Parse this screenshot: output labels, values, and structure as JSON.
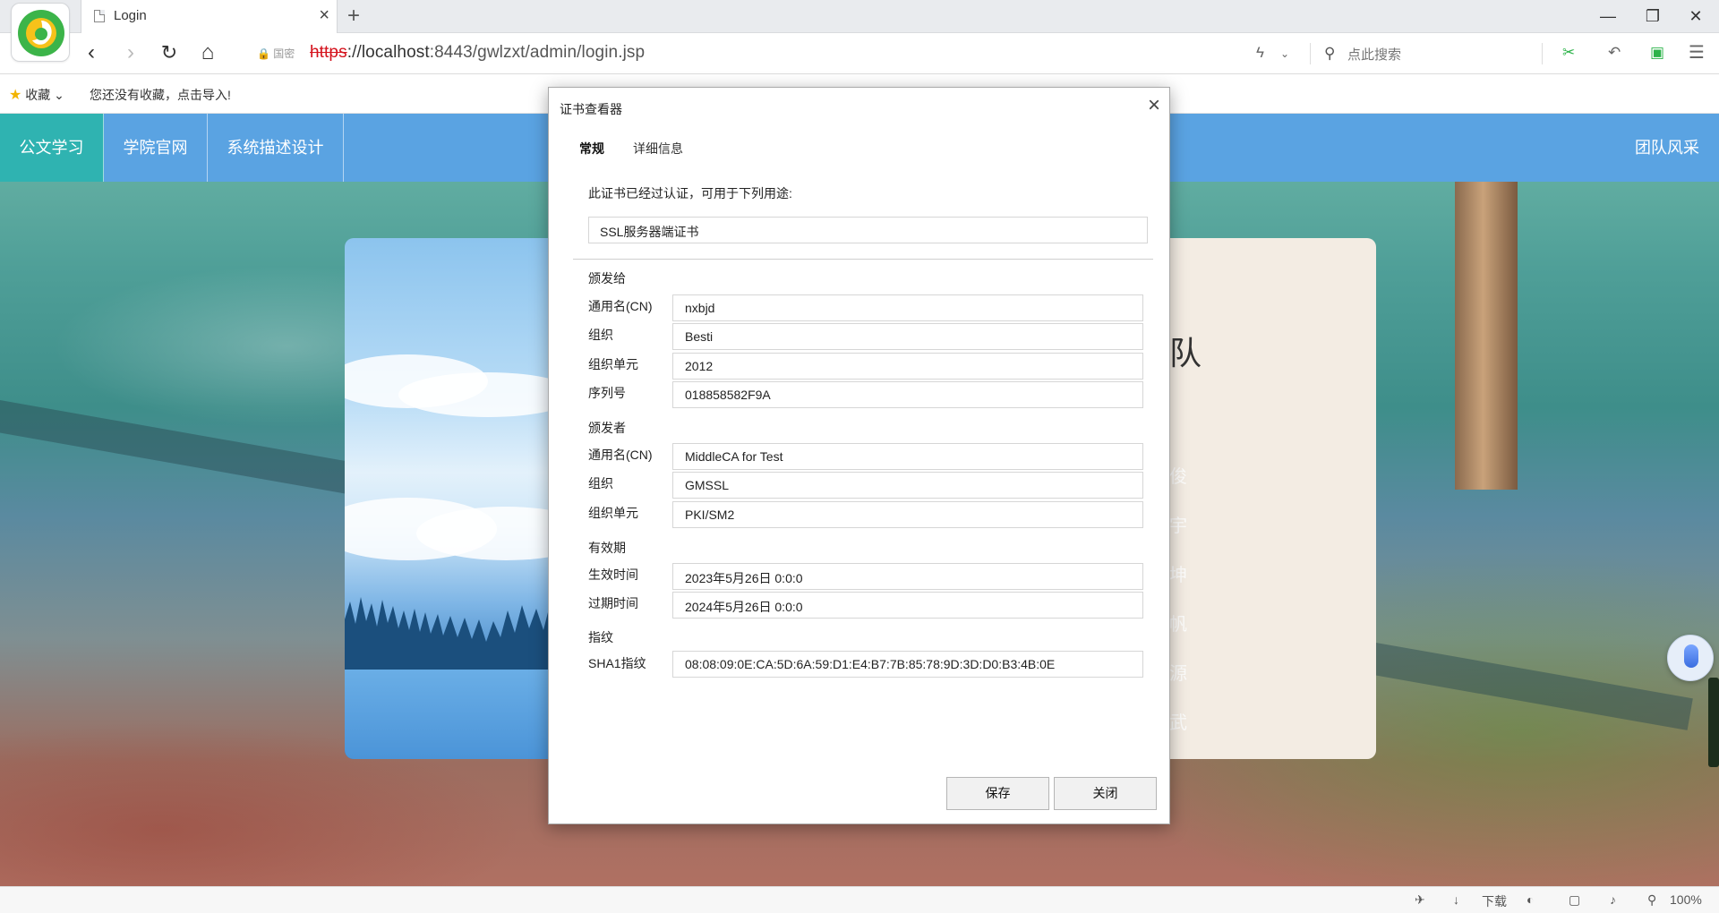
{
  "browser": {
    "tab_title": "Login",
    "tab_close": "×",
    "new_tab": "+",
    "security_label": "国密",
    "url_scheme": "https",
    "url_host": "://localhost",
    "url_rest": ":8443/gwlzxt/admin/login.jsp",
    "search_placeholder": "点此搜索",
    "window_controls": {
      "minimize": "—",
      "restore": "❐",
      "close": "✕"
    },
    "nav": {
      "back": "‹",
      "forward": "›",
      "reload": "↻",
      "home": "⌂"
    },
    "toolbar_icons": [
      "lightning-icon",
      "scissors-icon",
      "undo-icon",
      "chat-icon",
      "menu-icon"
    ]
  },
  "favorites": {
    "label": "收藏",
    "empty_text": "您还没有收藏，点击导入!"
  },
  "site_nav": {
    "items": [
      {
        "label": "公文学习"
      },
      {
        "label": "学院官网"
      },
      {
        "label": "系统描述设计"
      }
    ],
    "right": "团队风采"
  },
  "card_right": {
    "heading_glyph": "队",
    "side_glyphs": [
      "俊",
      "宇",
      "坤",
      "帆",
      "源",
      "武"
    ]
  },
  "dialog": {
    "title": "证书查看器",
    "close": "×",
    "tabs": [
      {
        "label": "常规",
        "active": true
      },
      {
        "label": "详细信息",
        "active": false
      }
    ],
    "purpose_text": "此证书已经过认证，可用于下列用途:",
    "purpose_value": "SSL服务器端证书",
    "issued_to": {
      "title": "颁发给",
      "fields": [
        {
          "label": "通用名(CN)",
          "value": "nxbjd"
        },
        {
          "label": "组织",
          "value": "Besti"
        },
        {
          "label": "组织单元",
          "value": "2012"
        },
        {
          "label": "序列号",
          "value": "018858582F9A"
        }
      ]
    },
    "issued_by": {
      "title": "颁发者",
      "fields": [
        {
          "label": "通用名(CN)",
          "value": "MiddleCA for Test"
        },
        {
          "label": "组织",
          "value": "GMSSL"
        },
        {
          "label": "组织单元",
          "value": "PKI/SM2"
        }
      ]
    },
    "validity": {
      "title": "有效期",
      "fields": [
        {
          "label": "生效时间",
          "value": "2023年5月26日 0:0:0"
        },
        {
          "label": "过期时间",
          "value": "2024年5月26日 0:0:0"
        }
      ]
    },
    "fingerprint": {
      "title": "指纹",
      "fields": [
        {
          "label": "SHA1指纹",
          "value": "08:08:09:0E:CA:5D:6A:59:D1:E4:B7:7B:85:78:9D:3D:D0:B3:4B:0E"
        }
      ]
    },
    "buttons": {
      "save": "保存",
      "close": "关闭"
    }
  },
  "status_bar": {
    "download": "下载",
    "zoom": "100%"
  },
  "colors": {
    "site_nav": "#5aa3e2",
    "site_nav_active": "#2fb3b1",
    "url_scheme": "#d4121c"
  }
}
